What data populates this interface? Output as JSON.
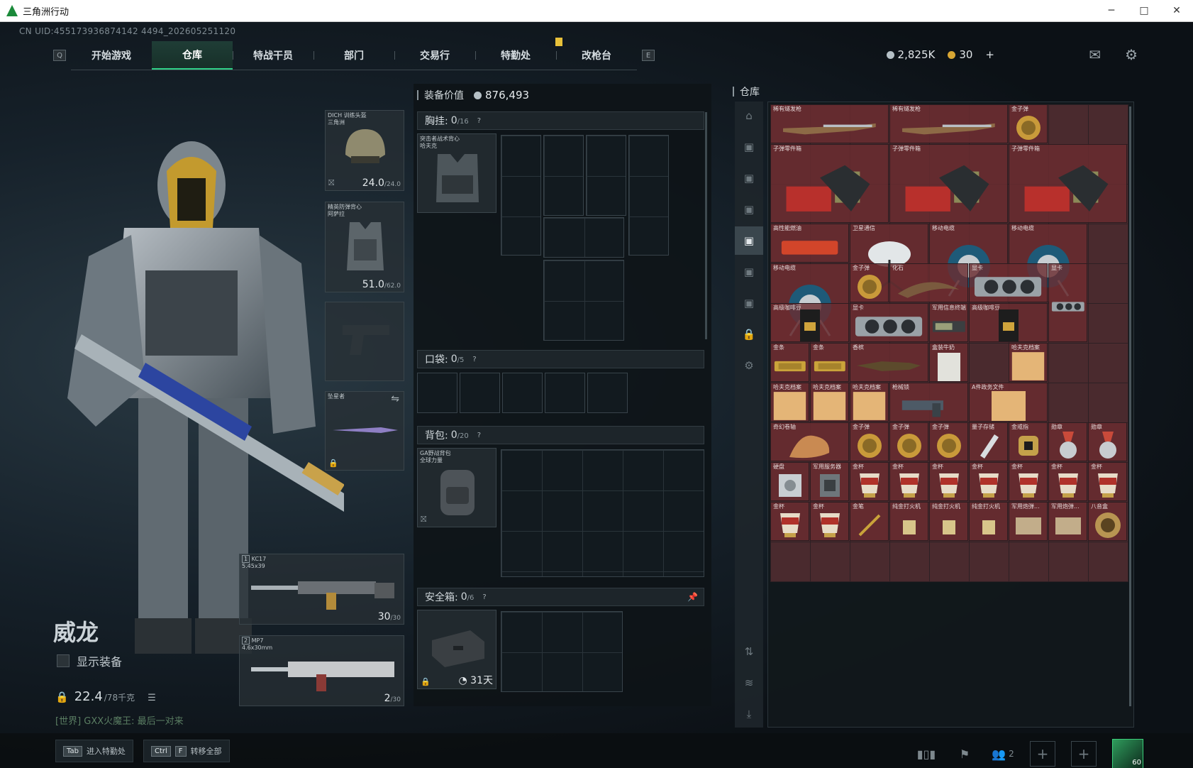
{
  "window": {
    "title": "三角洲行动",
    "minimize": "─",
    "maximize": "□",
    "close": "✕"
  },
  "uid": "CN UID:455173936874142 4494_202605251120",
  "nav": {
    "left_key": "Q",
    "right_key": "E",
    "tabs": [
      "开始游戏",
      "仓库",
      "特战干员",
      "部门",
      "交易行",
      "特勤处",
      "改枪台"
    ],
    "active": "仓库"
  },
  "currency": {
    "silver": "2,825K",
    "gold": "30",
    "add": "+"
  },
  "operator": {
    "name": "威龙",
    "show_gear_label": "显示装备",
    "weight": "22.4",
    "weight_max": "/78千克",
    "chat": "[世界] GXX火魔王: 最后一对来"
  },
  "gear_slots": {
    "helmet": {
      "label": "DICH 训练头盔\n三角洲",
      "durability": "24.0",
      "max": "/24.0"
    },
    "armor": {
      "label": "精英防弹背心\n阿萨拉",
      "durability": "51.0",
      "max": "/62.0"
    },
    "melee": {
      "label": "坠星者",
      "swap_icon": "⇋"
    },
    "primary": {
      "index": "1",
      "name": "KC17",
      "caliber": "5.45x39",
      "ammo": "30",
      "ammo_max": "/30"
    },
    "secondary": {
      "index": "2",
      "name": "MP7",
      "caliber": "4.6x30mm",
      "ammo": "2",
      "ammo_max": "/30"
    }
  },
  "loadout": {
    "value_label": "装备价值",
    "value": "876,493",
    "chest_rig": {
      "label": "胸挂:",
      "count": "0",
      "cap": "/16",
      "item": "突击者战术背心\n哈夫克"
    },
    "pockets": {
      "label": "口袋:",
      "count": "0",
      "cap": "/5"
    },
    "backpack": {
      "label": "背包:",
      "count": "0",
      "cap": "/20",
      "item": "GA野战背包\n全球力量"
    },
    "safe_box": {
      "label": "安全箱:",
      "count": "0",
      "cap": "/6",
      "timer": "31天"
    }
  },
  "warehouse": {
    "title": "仓库",
    "items": [
      {
        "name": "稀有燧发枪",
        "glyph": "rifle"
      },
      {
        "name": "稀有燧发枪",
        "glyph": "rifle"
      },
      {
        "name": "金子弹",
        "glyph": "coin"
      },
      {
        "name": "子弹零件箱",
        "glyph": "crate"
      },
      {
        "name": "子弹零件箱",
        "glyph": "crate"
      },
      {
        "name": "子弹零件箱",
        "glyph": "crate"
      },
      {
        "name": "高性能燃油",
        "glyph": "fuel"
      },
      {
        "name": "卫星通信",
        "glyph": "dish"
      },
      {
        "name": "移动电缆",
        "glyph": "reel"
      },
      {
        "name": "移动电缆",
        "glyph": "reel"
      },
      {
        "name": "移动电缆",
        "glyph": "reel"
      },
      {
        "name": "金子弹",
        "glyph": "coin"
      },
      {
        "name": "化石",
        "glyph": "fossil"
      },
      {
        "name": "显卡",
        "glyph": "gpu"
      },
      {
        "name": "显卡",
        "glyph": "gpu"
      },
      {
        "name": "高级咖啡豆",
        "glyph": "coffee"
      },
      {
        "name": "显卡",
        "glyph": "gpu"
      },
      {
        "name": "军用信息终端",
        "glyph": "terminal"
      },
      {
        "name": "高级咖啡豆",
        "glyph": "coffee"
      },
      {
        "name": "金条",
        "glyph": "gold"
      },
      {
        "name": "金条",
        "glyph": "gold"
      },
      {
        "name": "香槟",
        "glyph": "bottle"
      },
      {
        "name": "盒装牛奶",
        "glyph": "box"
      },
      {
        "name": "哈夫克档案",
        "glyph": "file"
      },
      {
        "name": "哈夫克档案",
        "glyph": "file"
      },
      {
        "name": "哈夫克档案",
        "glyph": "file"
      },
      {
        "name": "哈夫克档案",
        "glyph": "file"
      },
      {
        "name": "枪械锁",
        "glyph": "lock"
      },
      {
        "name": "A件政务文件",
        "glyph": "file"
      },
      {
        "name": "奇幻卷轴",
        "glyph": "scroll"
      },
      {
        "name": "金子弹",
        "glyph": "coin"
      },
      {
        "name": "金子弹",
        "glyph": "coin"
      },
      {
        "name": "金子弹",
        "glyph": "coin"
      },
      {
        "name": "量子存储",
        "glyph": "drive"
      },
      {
        "name": "金戒指",
        "glyph": "ring"
      },
      {
        "name": "勋章",
        "glyph": "medal"
      },
      {
        "name": "勋章",
        "glyph": "medal"
      },
      {
        "name": "硬盘",
        "glyph": "disk"
      },
      {
        "name": "军用服务器",
        "glyph": "server"
      },
      {
        "name": "金杯",
        "glyph": "cup"
      },
      {
        "name": "金杯",
        "glyph": "cup"
      },
      {
        "name": "金杯",
        "glyph": "cup"
      },
      {
        "name": "金杯",
        "glyph": "cup"
      },
      {
        "name": "金杯",
        "glyph": "cup"
      },
      {
        "name": "金杯",
        "glyph": "cup"
      },
      {
        "name": "金杯",
        "glyph": "cup"
      },
      {
        "name": "金杯",
        "glyph": "cup"
      },
      {
        "name": "金杯",
        "glyph": "cup"
      },
      {
        "name": "金笔",
        "glyph": "pen"
      },
      {
        "name": "纯金打火机",
        "glyph": "lighter"
      },
      {
        "name": "纯金打火机",
        "glyph": "lighter"
      },
      {
        "name": "纯金打火机",
        "glyph": "lighter"
      },
      {
        "name": "军用炮弹...",
        "glyph": "ammo"
      },
      {
        "name": "军用炮弹...",
        "glyph": "ammo"
      },
      {
        "name": "八音盒",
        "glyph": "music"
      }
    ]
  },
  "bottom": {
    "tab_key": "Tab",
    "tab_label": "进入特勤处",
    "ctrl_key": "Ctrl",
    "f_key": "F",
    "transfer_label": "转移全部",
    "squad_count": "2",
    "season_level": "60"
  }
}
